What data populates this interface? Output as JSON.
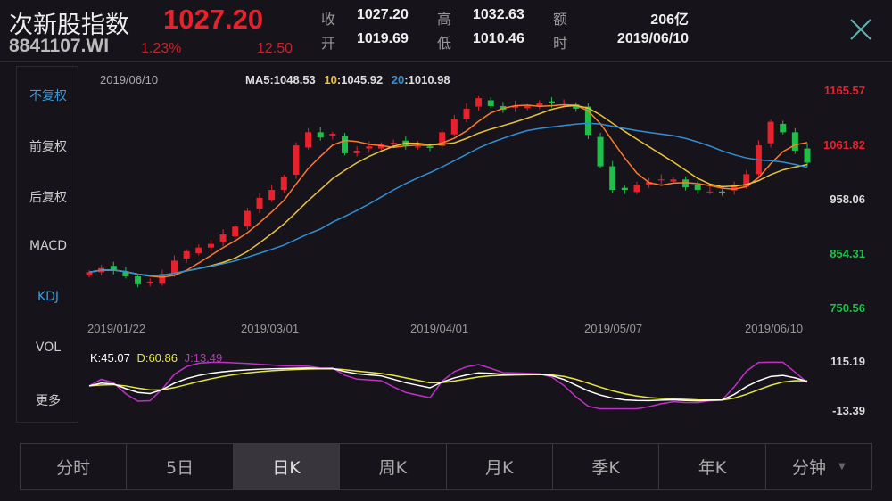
{
  "header": {
    "title": "次新股指数",
    "code": "8841107.WI",
    "price": "1027.20",
    "change_pct": "1.23%",
    "change": "12.50",
    "stats": [
      {
        "label": "收",
        "value": "1027.20"
      },
      {
        "label": "开",
        "value": "1019.69"
      },
      {
        "label": "高",
        "value": "1032.63"
      },
      {
        "label": "低",
        "value": "1010.46"
      },
      {
        "label": "额",
        "value": "206亿"
      },
      {
        "label": "时",
        "value": "2019/06/10"
      }
    ]
  },
  "sidebar": {
    "items": [
      {
        "label": "不复权",
        "active": true
      },
      {
        "label": "前复权"
      },
      {
        "label": "后复权"
      },
      {
        "label": "MACD"
      },
      {
        "label": "KDJ",
        "active": true
      },
      {
        "label": "VOL"
      },
      {
        "label": "更多"
      }
    ]
  },
  "tabs": [
    {
      "label": "分时"
    },
    {
      "label": "5日"
    },
    {
      "label": "日K",
      "active": true
    },
    {
      "label": "周K"
    },
    {
      "label": "月K"
    },
    {
      "label": "季K"
    },
    {
      "label": "年K"
    },
    {
      "label": "分钟",
      "dropdown": true
    }
  ],
  "colors": {
    "up": "#e8212c",
    "down": "#1fbf4a",
    "ma5": "#ff7a2a",
    "ma10": "#e8c23a",
    "ma20": "#2f8fd6",
    "k": "#ffffff",
    "d": "#e6e640",
    "j": "#c030c8"
  },
  "chart_data": {
    "type": "candlestick",
    "date": "2019/06/10",
    "ma_legend": {
      "ma5_label": "MA5",
      "ma5": ":1048.53",
      "ma10_label": "10",
      "ma10": ":1045.92",
      "ma20_label": "20",
      "ma20": ":1010.98"
    },
    "y_ticks": [
      "1165.57",
      "1061.82",
      "958.06",
      "854.31",
      "750.56"
    ],
    "ylim": [
      750.56,
      1165.57
    ],
    "x_ticks": [
      "2019/01/22",
      "2019/03/01",
      "2019/04/01",
      "2019/05/07",
      "2019/06/10"
    ],
    "closes": [
      818,
      826,
      822,
      810,
      795,
      800,
      815,
      840,
      858,
      865,
      872,
      890,
      905,
      935,
      960,
      975,
      1000,
      1060,
      1085,
      1075,
      1082,
      1045,
      1050,
      1058,
      1062,
      1065,
      1060,
      1058,
      1055,
      1085,
      1110,
      1130,
      1150,
      1135,
      1128,
      1135,
      1135,
      1140,
      1140,
      1138,
      1130,
      1080,
      1020,
      975,
      975,
      985,
      990,
      995,
      995,
      980,
      975,
      972,
      970,
      985,
      1005,
      1060,
      1105,
      1085,
      1050,
      1027
    ],
    "kdj_legend": {
      "k": "K:45.07",
      "d": "D:60.86",
      "j": "J:13.49"
    },
    "kdj_ticks": [
      "115.19",
      "-13.39"
    ],
    "kdj_ylim": [
      -13.39,
      115.19
    ]
  }
}
